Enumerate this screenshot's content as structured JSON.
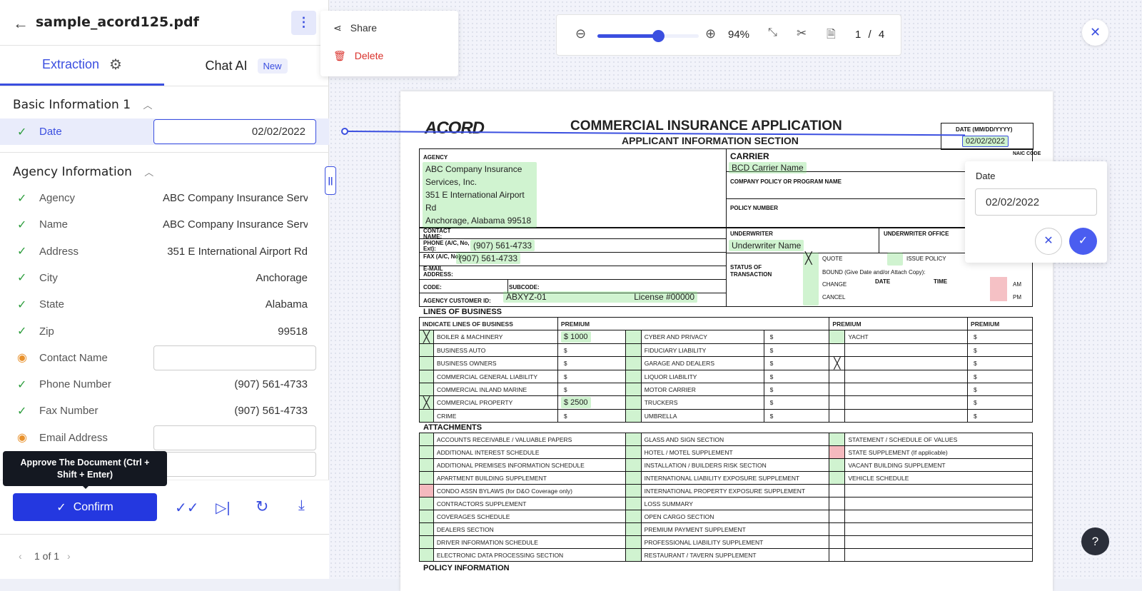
{
  "header": {
    "file_name": "sample_acord125.pdf"
  },
  "menu": {
    "share": "Share",
    "delete": "Delete"
  },
  "tabs": {
    "extraction": "Extraction",
    "chat": "Chat AI",
    "chat_badge": "New"
  },
  "sections": [
    {
      "title": "Basic Information 1",
      "fields": [
        {
          "label": "Date",
          "value": "02/02/2022",
          "status": "ok",
          "input": true
        }
      ]
    },
    {
      "title": "Agency Information",
      "fields": [
        {
          "label": "Agency",
          "value": "ABC Company Insurance Services, Inc.",
          "status": "ok"
        },
        {
          "label": "Name",
          "value": "ABC Company Insurance Services, Inc.",
          "status": "ok"
        },
        {
          "label": "Address",
          "value": "351 E International Airport Rd",
          "status": "ok"
        },
        {
          "label": "City",
          "value": "Anchorage",
          "status": "ok"
        },
        {
          "label": "State",
          "value": "Alabama",
          "status": "ok"
        },
        {
          "label": "Zip",
          "value": "99518",
          "status": "ok"
        },
        {
          "label": "Contact Name",
          "value": "",
          "status": "review"
        },
        {
          "label": "Phone Number",
          "value": "(907) 561-4733",
          "status": "ok"
        },
        {
          "label": "Fax Number",
          "value": "(907) 561-4733",
          "status": "ok"
        },
        {
          "label": "Email Address",
          "value": "",
          "status": "review"
        }
      ]
    }
  ],
  "footer": {
    "tooltip": "Approve The Document (Ctrl + Shift + Enter)",
    "confirm": "Confirm",
    "pagination": "1 of 1"
  },
  "toolbar": {
    "zoom": "94%",
    "zoom_fraction": 0.6,
    "page_current": "1",
    "page_sep": "/",
    "page_total": "4"
  },
  "popover": {
    "label": "Date",
    "value": "02/02/2022"
  },
  "doc": {
    "title": "COMMERCIAL INSURANCE APPLICATION",
    "subtitle": "APPLICANT INFORMATION SECTION",
    "logo": "ACORD",
    "date_label": "DATE (MM/DD/YYYY)",
    "date": "02/02/2022",
    "naic": "NAIC CODE",
    "agency_label": "AGENCY",
    "agency_lines": [
      "ABC Company Insurance Services, Inc.",
      "351 E International Airport Rd",
      "Anchorage, Alabama 99518"
    ],
    "carrier_label": "CARRIER",
    "carrier": "BCD Carrier Name",
    "program_label": "COMPANY POLICY OR PROGRAM NAME",
    "policy_label": "POLICY NUMBER",
    "contact_label": "CONTACT NAME:",
    "phone_label": "PHONE (A/C, No, Ext):",
    "phone": "(907) 561-4733",
    "fax_label": "FAX (A/C, No):",
    "fax": "(907) 561-4733",
    "email_label": "E-MAIL ADDRESS:",
    "code_label": "CODE:",
    "subcode_label": "SUBCODE:",
    "customer_id_label": "AGENCY CUSTOMER ID:",
    "customer_id": "ABXYZ-01",
    "license": "License #00000",
    "underwriter_label": "UNDERWRITER",
    "underwriter": "Underwriter Name",
    "underwriter_office_label": "UNDERWRITER OFFICE",
    "status_label": "STATUS OF TRANSACTION",
    "quote": "QUOTE",
    "issue": "ISSUE POLICY",
    "bound": "BOUND (Give Date and/or Attach Copy):",
    "change": "CHANGE",
    "cancel": "CANCEL",
    "date_col": "DATE",
    "time_col": "TIME",
    "am": "AM",
    "pm": "PM",
    "lob_title": "LINES OF BUSINESS",
    "lob_headers": [
      "INDICATE LINES OF BUSINESS",
      "PREMIUM",
      "PREMIUM",
      "PREMIUM"
    ],
    "lob_rows": [
      [
        {
          "x": true,
          "label": "BOILER & MACHINERY",
          "premium": "$ 1000"
        },
        {
          "label": "CYBER AND PRIVACY",
          "premium": "$"
        },
        {
          "label": "YACHT",
          "premium": "$"
        }
      ],
      [
        {
          "label": "BUSINESS AUTO",
          "premium": "$"
        },
        {
          "label": "FIDUCIARY LIABILITY",
          "premium": "$"
        },
        {
          "e": true,
          "label": "",
          "premium": "$"
        }
      ],
      [
        {
          "label": "BUSINESS OWNERS",
          "premium": "$"
        },
        {
          "label": "GARAGE AND DEALERS",
          "premium": "$"
        },
        {
          "e": true,
          "x": true,
          "label": "",
          "premium": "$"
        }
      ],
      [
        {
          "label": "COMMERCIAL GENERAL LIABILITY",
          "premium": "$"
        },
        {
          "label": "LIQUOR LIABILITY",
          "premium": "$"
        },
        {
          "e": true,
          "label": "",
          "premium": "$"
        }
      ],
      [
        {
          "label": "COMMERCIAL INLAND MARINE",
          "premium": "$"
        },
        {
          "label": "MOTOR CARRIER",
          "premium": "$"
        },
        {
          "e": true,
          "label": "",
          "premium": "$"
        }
      ],
      [
        {
          "x": true,
          "label": "COMMERCIAL PROPERTY",
          "premium": "$ 2500"
        },
        {
          "label": "TRUCKERS",
          "premium": "$"
        },
        {
          "e": true,
          "label": "",
          "premium": "$"
        }
      ],
      [
        {
          "label": "CRIME",
          "premium": "$"
        },
        {
          "label": "UMBRELLA",
          "premium": "$"
        },
        {
          "e": true,
          "label": "",
          "premium": "$"
        }
      ]
    ],
    "att_title": "ATTACHMENTS",
    "att_rows": [
      [
        {
          "label": "ACCOUNTS RECEIVABLE / VALUABLE PAPERS"
        },
        {
          "label": "GLASS AND SIGN SECTION"
        },
        {
          "label": "STATEMENT / SCHEDULE OF VALUES"
        }
      ],
      [
        {
          "label": "ADDITIONAL INTEREST SCHEDULE"
        },
        {
          "label": "HOTEL / MOTEL SUPPLEMENT"
        },
        {
          "r": true,
          "label": "STATE SUPPLEMENT (If applicable)"
        }
      ],
      [
        {
          "label": "ADDITIONAL PREMISES INFORMATION SCHEDULE"
        },
        {
          "label": "INSTALLATION / BUILDERS RISK SECTION"
        },
        {
          "label": "VACANT BUILDING SUPPLEMENT"
        }
      ],
      [
        {
          "label": "APARTMENT BUILDING SUPPLEMENT"
        },
        {
          "label": "INTERNATIONAL LIABILITY EXPOSURE SUPPLEMENT"
        },
        {
          "label": "VEHICLE SCHEDULE"
        }
      ],
      [
        {
          "r": true,
          "label": "CONDO ASSN BYLAWS (for D&O Coverage only)"
        },
        {
          "label": "INTERNATIONAL PROPERTY EXPOSURE SUPPLEMENT"
        },
        {
          "e": true,
          "label": ""
        }
      ],
      [
        {
          "label": "CONTRACTORS SUPPLEMENT"
        },
        {
          "label": "LOSS SUMMARY"
        },
        {
          "e": true,
          "label": ""
        }
      ],
      [
        {
          "label": "COVERAGES SCHEDULE"
        },
        {
          "label": "OPEN CARGO SECTION"
        },
        {
          "e": true,
          "label": ""
        }
      ],
      [
        {
          "label": "DEALERS SECTION"
        },
        {
          "label": "PREMIUM PAYMENT SUPPLEMENT"
        },
        {
          "e": true,
          "label": ""
        }
      ],
      [
        {
          "label": "DRIVER INFORMATION SCHEDULE"
        },
        {
          "label": "PROFESSIONAL LIABILITY SUPPLEMENT"
        },
        {
          "e": true,
          "label": ""
        }
      ],
      [
        {
          "label": "ELECTRONIC DATA PROCESSING SECTION"
        },
        {
          "label": "RESTAURANT / TAVERN SUPPLEMENT"
        },
        {
          "e": true,
          "label": ""
        }
      ]
    ],
    "policy_info": "POLICY INFORMATION"
  },
  "help": "?"
}
